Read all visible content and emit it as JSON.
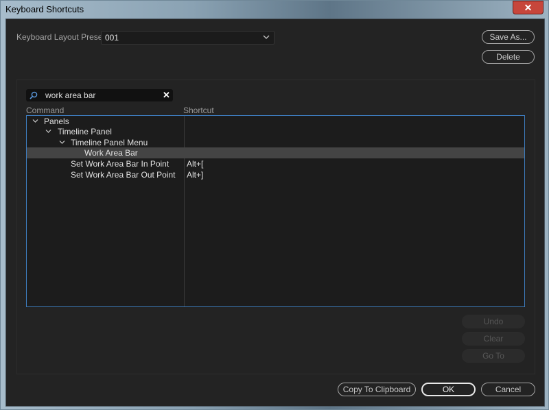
{
  "window": {
    "title": "Keyboard Shortcuts",
    "close_icon": "close-icon"
  },
  "preset": {
    "label": "Keyboard Layout Preset:",
    "value": "001"
  },
  "buttons": {
    "save_as": "Save As...",
    "delete": "Delete",
    "undo": "Undo",
    "clear": "Clear",
    "go_to": "Go To",
    "copy": "Copy To Clipboard",
    "ok": "OK",
    "cancel": "Cancel"
  },
  "search": {
    "value": "work area bar",
    "icon": "search-icon",
    "clear_icon": "clear-icon"
  },
  "columns": {
    "command": "Command",
    "shortcut": "Shortcut"
  },
  "tree": [
    {
      "label": "Panels",
      "shortcut": "",
      "expanded": true,
      "selected": false
    },
    {
      "label": "Timeline Panel",
      "shortcut": "",
      "expanded": true,
      "selected": false
    },
    {
      "label": "Timeline Panel Menu",
      "shortcut": "",
      "expanded": true,
      "selected": false
    },
    {
      "label": "Work Area Bar",
      "shortcut": "",
      "expanded": false,
      "selected": true
    },
    {
      "label": "Set Work Area Bar In Point",
      "shortcut": "Alt+[",
      "expanded": false,
      "selected": false
    },
    {
      "label": "Set Work Area Bar Out Point",
      "shortcut": "Alt+]",
      "expanded": false,
      "selected": false
    }
  ],
  "colors": {
    "accent_blue": "#3e7dbf",
    "close_red": "#c7463b",
    "background": "#232323"
  }
}
